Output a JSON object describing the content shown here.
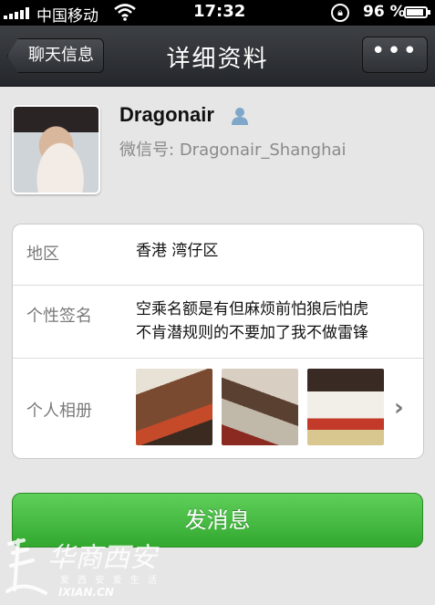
{
  "status_bar": {
    "carrier": "中国移动",
    "time": "17:32",
    "battery_percent": "96 %",
    "battery_level": 0.96
  },
  "nav": {
    "back_label": "聊天信息",
    "title": "详细资料",
    "more_label": "•••"
  },
  "profile": {
    "name": "Dragonair",
    "wechat_id_label": "微信号:",
    "wechat_id": "Dragonair_Shanghai"
  },
  "info": {
    "region_label": "地区",
    "region_value": "香港 湾仔区",
    "signature_label": "个性签名",
    "signature_line1": "空乘名额是有但麻烦前怕狼后怕虎",
    "signature_line2": "不肯潜规则的不要加了我不做雷锋",
    "album_label": "个人相册"
  },
  "actions": {
    "send_message_label": "发消息"
  },
  "watermark": {
    "title": "华商西安",
    "subtitle": "爱 西 安 爱 生 活",
    "url": "IXIAN.CN"
  },
  "colors": {
    "send_button": "#3cb838",
    "navbar": "#2e3135",
    "background": "#e6e6e6"
  }
}
